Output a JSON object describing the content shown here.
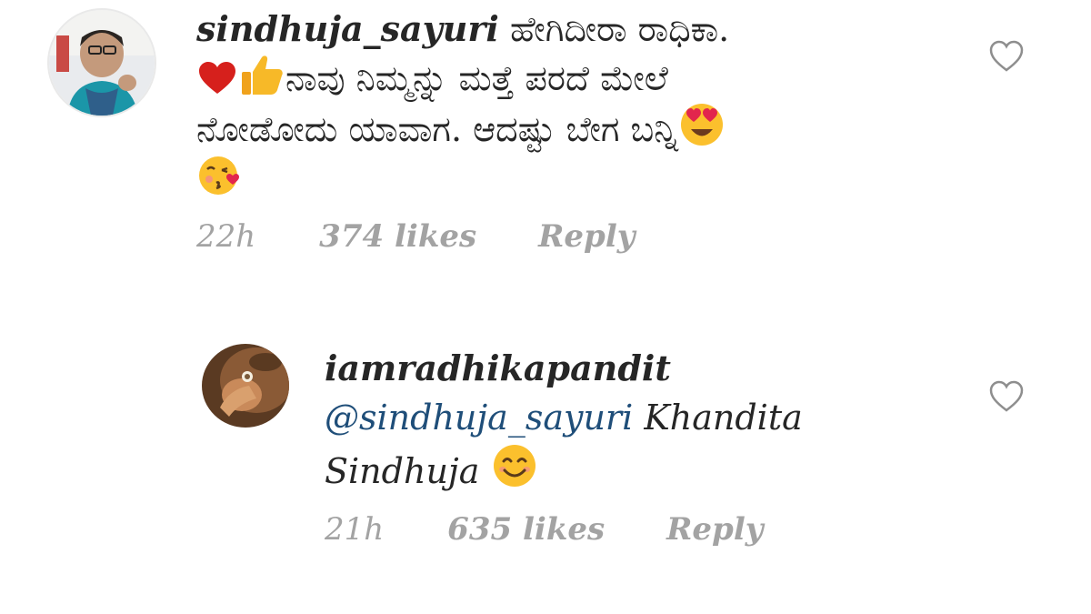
{
  "comments": [
    {
      "username": "sindhuja_sayuri",
      "text_line1": "ಹೇಗಿದೀರಾ  ರಾಧಿಕಾ.",
      "text_line2": "ನಾವು ನಿಮ್ಮನ್ನು ಮತ್ತೆ ಪರದೆ ಮೇಲೆ",
      "text_line3": "ನೋಡೋದು ಯಾವಾಗ. ಆದಷ್ಟು ಬೇಗ ಬನ್ನಿ",
      "emojis": [
        "red-heart",
        "thumbs-up",
        "heart-eyes",
        "kissing-face"
      ],
      "time": "22h",
      "likes": "374 likes",
      "reply_label": "Reply"
    },
    {
      "username": "iamradhikapandit",
      "mention": "@sindhuja_sayuri",
      "text_part1": "Khandita",
      "text_part2": "Sindhuja",
      "emojis": [
        "smiling-face"
      ],
      "time": "21h",
      "likes": "635 likes",
      "reply_label": "Reply"
    }
  ],
  "colors": {
    "text": "#262626",
    "meta": "#a3a3a3",
    "mention": "#1f4e79",
    "like_icon": "#8e8e8e"
  }
}
